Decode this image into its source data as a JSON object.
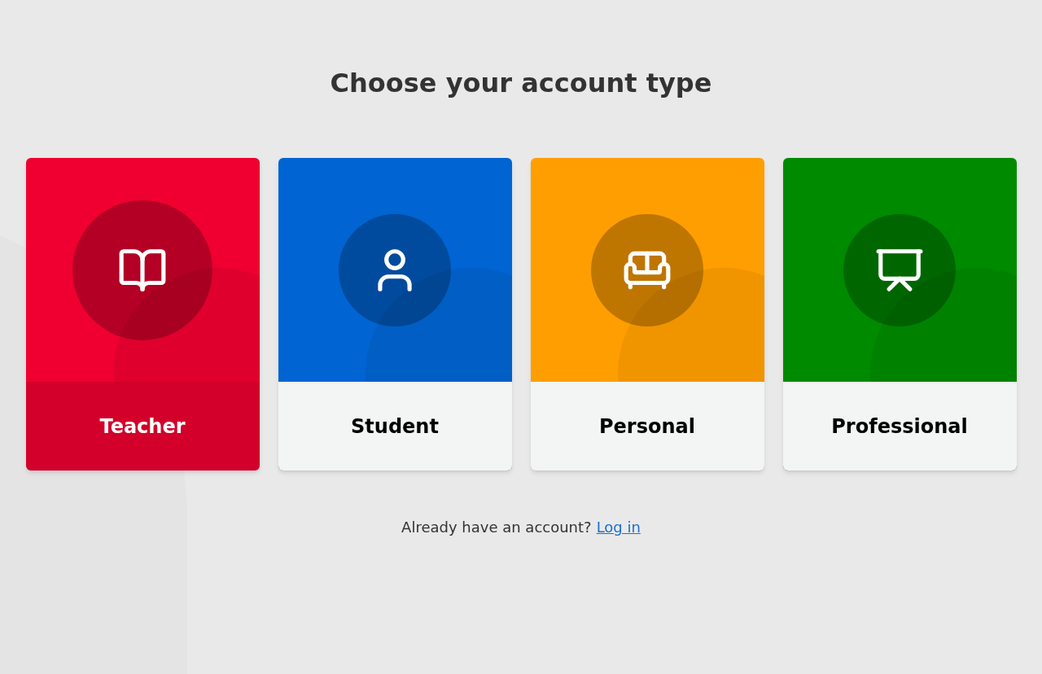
{
  "title": "Choose your account type",
  "cards": [
    {
      "label": "Teacher",
      "kind": "book",
      "color": "#ef0030",
      "selected": true
    },
    {
      "label": "Student",
      "kind": "person",
      "color": "#0064d2",
      "selected": false
    },
    {
      "label": "Personal",
      "kind": "sofa",
      "color": "#ff9e00",
      "selected": false
    },
    {
      "label": "Professional",
      "kind": "presentation",
      "color": "#008a00",
      "selected": false
    }
  ],
  "footer": {
    "text": "Already have an account?",
    "link": "Log in"
  }
}
